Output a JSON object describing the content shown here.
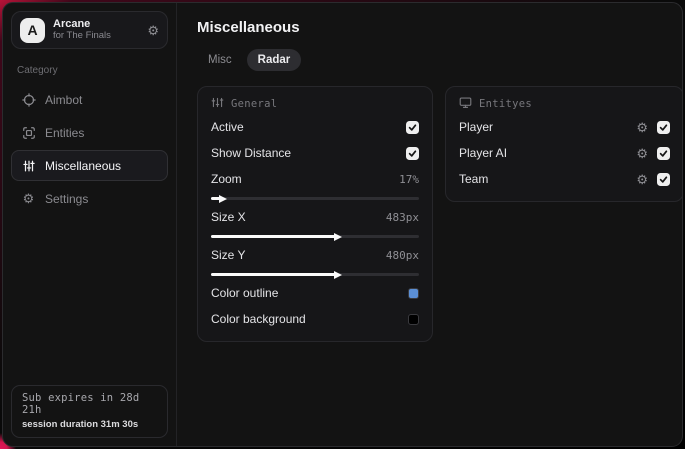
{
  "colors": {
    "backdrop_red": "#b81338",
    "accent_blue": "#5b8fd6",
    "swatch_black": "#000000"
  },
  "sidebar": {
    "profile": {
      "initial": "A",
      "title": "Arcane",
      "subtitle": "for The Finals",
      "gear_icon": "gear-icon"
    },
    "category_label": "Category",
    "items": [
      {
        "label": "Aimbot",
        "icon": "crosshair-icon",
        "active": false
      },
      {
        "label": "Entities",
        "icon": "entities-box-icon",
        "active": false
      },
      {
        "label": "Miscellaneous",
        "icon": "sliders-icon",
        "active": true
      },
      {
        "label": "Settings",
        "icon": "gear-icon",
        "active": false
      }
    ],
    "subscription": {
      "line1": "Sub expires in 28d 21h",
      "line2": "session duration 31m 30s"
    }
  },
  "main": {
    "title": "Miscellaneous",
    "tabs": [
      {
        "label": "Misc",
        "active": false
      },
      {
        "label": "Radar",
        "active": true
      }
    ],
    "general_card": {
      "header": "General",
      "header_icon": "adjust-sliders-icon",
      "rows": [
        {
          "type": "checkbox",
          "label": "Active",
          "checked": true
        },
        {
          "type": "checkbox",
          "label": "Show Distance",
          "checked": true
        },
        {
          "type": "slider",
          "label": "Zoom",
          "value": "17%",
          "fill_pct": 5
        },
        {
          "type": "slider",
          "label": "Size X",
          "value": "483px",
          "fill_pct": 60
        },
        {
          "type": "slider",
          "label": "Size Y",
          "value": "480px",
          "fill_pct": 60
        },
        {
          "type": "color",
          "label": "Color outline",
          "color": "#5b8fd6"
        },
        {
          "type": "color",
          "label": "Color background",
          "color": "#000000"
        }
      ]
    },
    "entities_card": {
      "header": "Entityes",
      "header_icon": "monitor-icon",
      "rows": [
        {
          "label": "Player",
          "gear_icon": "gear-icon",
          "checked": true
        },
        {
          "label": "Player AI",
          "gear_icon": "gear-icon",
          "checked": true
        },
        {
          "label": "Team",
          "gear_icon": "gear-icon",
          "checked": true
        }
      ]
    }
  }
}
